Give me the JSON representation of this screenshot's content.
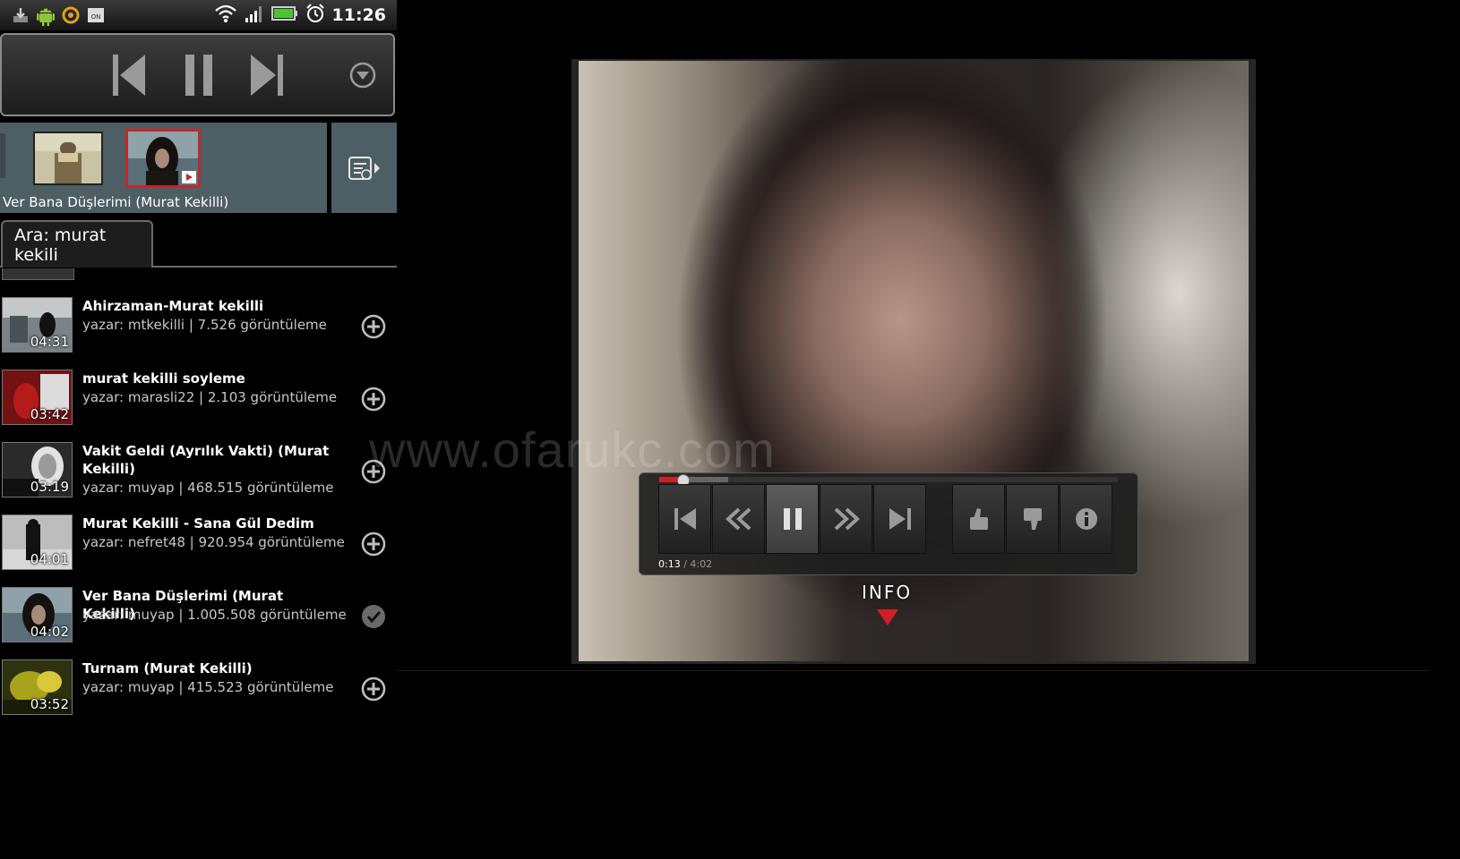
{
  "status_bar": {
    "time": "11:26",
    "left_icons": [
      "download-icon",
      "android-icon",
      "sync-icon",
      "on-badge-icon"
    ],
    "right_icons": [
      "wifi-icon",
      "signal-icon",
      "battery-icon",
      "alarm-icon"
    ],
    "on_badge": "ON"
  },
  "player": {
    "controls": [
      "previous-icon",
      "pause-icon",
      "next-icon",
      "dropdown-icon"
    ]
  },
  "queue": {
    "now_playing": "Ver Bana Düşlerimi (Murat Kekilli)"
  },
  "search": {
    "tab_label": "Ara: murat kekili"
  },
  "results": [
    {
      "title": "Ahirzaman-Murat kekilli",
      "meta": "yazar: mtkekilli | 7.526 görüntüleme",
      "duration": "04:31",
      "action": "add"
    },
    {
      "title": "murat kekilli soyleme",
      "meta": "yazar: marasli22 | 2.103 görüntüleme",
      "duration": "03:42",
      "action": "add"
    },
    {
      "title": "Vakit Geldi (Ayrılık Vakti) (Murat Kekilli)",
      "meta": "yazar: muyap | 468.515 görüntüleme",
      "duration": "03:19",
      "action": "add"
    },
    {
      "title": "Murat Kekilli - Sana Gül Dedim",
      "meta": "yazar: nefret48 | 920.954 görüntüleme",
      "duration": "04:01",
      "action": "add"
    },
    {
      "title": "Ver Bana Düşlerimi (Murat Kekilli)",
      "meta": "yazar: muyap | 1.005.508 görüntüleme",
      "duration": "04:02",
      "action": "added"
    },
    {
      "title": "Turnam (Murat Kekilli)",
      "meta": "yazar: muyap | 415.523 görüntüleme",
      "duration": "03:52",
      "action": "add"
    }
  ],
  "video": {
    "watermark": "www.ofarukc.com",
    "elapsed": "0:13",
    "separator": "/",
    "total": "4:02",
    "progress": 0.05,
    "buffered": 0.15,
    "info_label": "INFO",
    "accent_color": "#d01f26"
  }
}
